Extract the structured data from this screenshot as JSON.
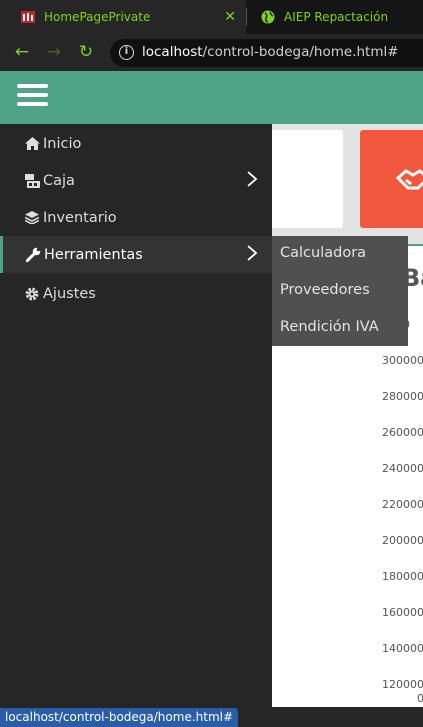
{
  "browser": {
    "tabs": [
      {
        "title": "HomePagePrivate",
        "active": true
      },
      {
        "title": "AIEP Repactación",
        "active": false
      }
    ],
    "url_host": "localhost",
    "url_path": "/control-bodega/home.html#",
    "status_url": "localhost/control-bodega/home.html#"
  },
  "colors": {
    "accent": "#4fa487",
    "sidebar": "#262626",
    "submenu": "#505050",
    "tab_text": "#7ed321",
    "card_red": "#f2583e"
  },
  "sidebar": {
    "items": [
      {
        "label": "Inicio",
        "icon": "home-icon"
      },
      {
        "label": "Caja",
        "icon": "cash-icon",
        "has_submenu": true
      },
      {
        "label": "Inventario",
        "icon": "layers-icon"
      },
      {
        "label": "Herramientas",
        "icon": "wrench-icon",
        "has_submenu": true,
        "active": true
      },
      {
        "label": "Ajustes",
        "icon": "gear-icon"
      }
    ]
  },
  "submenu": {
    "items": [
      "Calculadora",
      "Proveedores",
      "Rendición IVA"
    ]
  },
  "chart": {
    "title_fragment": "Ba",
    "y_ticks": [
      "300000",
      "280000",
      "260000",
      "240000",
      "220000",
      "200000",
      "180000",
      "160000",
      "140000",
      "120000"
    ],
    "top_partial_tick": "0000",
    "bottom_partial_tick": "0"
  }
}
